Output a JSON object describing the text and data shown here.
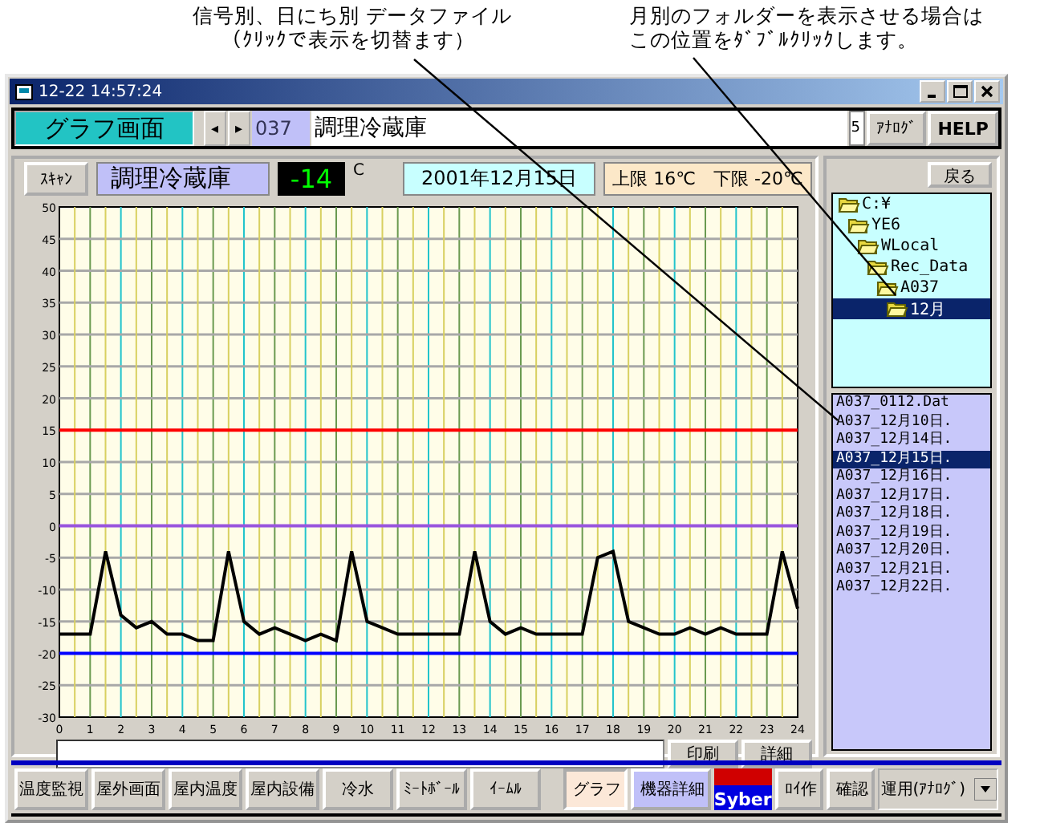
{
  "annotations": [
    {
      "text": "信号別、日にち別  データファイル",
      "subtext": "（ｸﾘｯｸで表示を切替ます）"
    },
    {
      "text": "月別のフォルダーを表示させる場合は",
      "subtext": "この位置をﾀﾞﾌﾞﾙｸﾘｯｸします。"
    }
  ],
  "window": {
    "title": "12-22 14:57:24"
  },
  "toolbar": {
    "screen_name": "グラフ画面",
    "prev": "◂",
    "next": "▸",
    "channel_no": "037",
    "channel_name": "調理冷蔵庫",
    "spin": "5",
    "analog_button": "ｱﾅﾛｸﾞ",
    "help_button": "HELP"
  },
  "header": {
    "scan_button": "ｽｷｬﾝ",
    "name": "調理冷蔵庫",
    "reading": "-14",
    "unit": "C",
    "date": "2001年12月15日",
    "limits": "上限 16℃　下限 -20℃"
  },
  "chart_data": {
    "type": "line",
    "x": [
      0,
      0.5,
      1,
      1.5,
      2,
      2.5,
      3,
      3.5,
      4,
      4.5,
      5,
      5.5,
      6,
      6.5,
      7,
      7.5,
      8,
      8.5,
      9,
      9.5,
      10,
      10.5,
      11,
      11.5,
      12,
      12.5,
      13,
      13.5,
      14,
      14.5,
      15,
      15.5,
      16,
      16.5,
      17,
      17.5,
      18,
      18.5,
      19,
      19.5,
      20,
      20.5,
      21,
      21.5,
      22,
      22.5,
      23,
      23.5,
      24
    ],
    "series": [
      {
        "color": "#000000",
        "values": [
          -17,
          -17,
          -17,
          -4,
          -14,
          -16,
          -15,
          -17,
          -17,
          -18,
          -18,
          -4,
          -15,
          -17,
          -16,
          -17,
          -18,
          -17,
          -18,
          -4,
          -15,
          -16,
          -17,
          -17,
          -17,
          -17,
          -17,
          -4,
          -15,
          -17,
          -16,
          -17,
          -17,
          -17,
          -17,
          -5,
          -4,
          -15,
          -16,
          -17,
          -17,
          -16,
          -17,
          -16,
          -17,
          -17,
          -17,
          -4,
          -13
        ]
      }
    ],
    "xlim": [
      0,
      24
    ],
    "ylim": [
      -30,
      50
    ],
    "xticks": [
      0,
      1,
      2,
      3,
      4,
      5,
      6,
      7,
      8,
      9,
      10,
      11,
      12,
      13,
      14,
      15,
      16,
      17,
      18,
      19,
      20,
      21,
      22,
      23,
      24
    ],
    "yticks": [
      50,
      45,
      40,
      35,
      30,
      25,
      20,
      15,
      10,
      5,
      0,
      -5,
      -10,
      -15,
      -20,
      -25,
      -30
    ],
    "grid": true,
    "ref_lines": [
      {
        "axis": "x",
        "value": 0.5,
        "color": "#d8d060"
      },
      {
        "axis": "x",
        "value": 1.5,
        "color": "#d8d060"
      },
      {
        "axis": "x",
        "value": 2.5,
        "color": "#d8d060"
      },
      {
        "axis": "x",
        "value": 3.5,
        "color": "#d8d060"
      },
      {
        "axis": "x",
        "value": 4.5,
        "color": "#d8d060"
      },
      {
        "axis": "x",
        "value": 5.5,
        "color": "#d8d060"
      },
      {
        "axis": "x",
        "value": 6.5,
        "color": "#d8d060"
      },
      {
        "axis": "x",
        "value": 7.5,
        "color": "#d8d060"
      },
      {
        "axis": "x",
        "value": 8.5,
        "color": "#d8d060"
      },
      {
        "axis": "x",
        "value": 9.5,
        "color": "#d8d060"
      },
      {
        "axis": "x",
        "value": 10.5,
        "color": "#d8d060"
      },
      {
        "axis": "x",
        "value": 11.5,
        "color": "#d8d060"
      },
      {
        "axis": "x",
        "value": 12.5,
        "color": "#d8d060"
      },
      {
        "axis": "x",
        "value": 13.5,
        "color": "#d8d060"
      },
      {
        "axis": "x",
        "value": 14.5,
        "color": "#d8d060"
      },
      {
        "axis": "x",
        "value": 15.5,
        "color": "#d8d060"
      },
      {
        "axis": "x",
        "value": 16.5,
        "color": "#d8d060"
      },
      {
        "axis": "x",
        "value": 17.5,
        "color": "#d8d060"
      },
      {
        "axis": "x",
        "value": 18.5,
        "color": "#d8d060"
      },
      {
        "axis": "x",
        "value": 19.5,
        "color": "#d8d060"
      },
      {
        "axis": "x",
        "value": 20.5,
        "color": "#d8d060"
      },
      {
        "axis": "x",
        "value": 21.5,
        "color": "#d8d060"
      },
      {
        "axis": "x",
        "value": 22.5,
        "color": "#d8d060"
      },
      {
        "axis": "x",
        "value": 23.5,
        "color": "#d8d060"
      },
      {
        "axis": "y",
        "value": 15,
        "color": "#ff0000"
      },
      {
        "axis": "y",
        "value": 0,
        "color": "#9955dd"
      },
      {
        "axis": "y",
        "value": -20,
        "color": "#0000ff"
      }
    ]
  },
  "footer": {
    "print_button": "印刷",
    "detail_button": "詳細"
  },
  "side": {
    "back_button": "戻る",
    "folders": [
      {
        "label": "C:¥",
        "selected": false,
        "children": [
          {
            "label": "YE6",
            "selected": false,
            "children": [
              {
                "label": "WLocal",
                "selected": false,
                "children": [
                  {
                    "label": "Rec_Data",
                    "selected": false,
                    "children": [
                      {
                        "label": "A037",
                        "selected": false,
                        "children": [
                          {
                            "label": "12月",
                            "selected": true
                          }
                        ]
                      }
                    ]
                  }
                ]
              }
            ]
          }
        ]
      }
    ],
    "files": [
      {
        "label": "A037_0112.Dat",
        "selected": false
      },
      {
        "label": "A037_12月10日.",
        "selected": false
      },
      {
        "label": "A037_12月14日.",
        "selected": false
      },
      {
        "label": "A037_12月15日.",
        "selected": true
      },
      {
        "label": "A037_12月16日.",
        "selected": false
      },
      {
        "label": "A037_12月17日.",
        "selected": false
      },
      {
        "label": "A037_12月18日.",
        "selected": false
      },
      {
        "label": "A037_12月19日.",
        "selected": false
      },
      {
        "label": "A037_12月20日.",
        "selected": false
      },
      {
        "label": "A037_12月21日.",
        "selected": false
      },
      {
        "label": "A037_12月22日.",
        "selected": false
      }
    ]
  },
  "nav_buttons": [
    {
      "label": "温度監視",
      "selected": false
    },
    {
      "label": "屋外画面",
      "selected": false
    },
    {
      "label": "屋内温度",
      "selected": false
    },
    {
      "label": "屋内設備",
      "selected": false
    },
    {
      "label": "冷水",
      "selected": false
    },
    {
      "label": "ﾐｰﾄﾎﾞｰﾙ",
      "selected": false
    },
    {
      "label": "ｲｰﾑﾙ",
      "selected": false
    }
  ],
  "view_buttons": [
    {
      "label": "グラフ",
      "selected": true
    },
    {
      "label": "機器詳細",
      "selected": false
    }
  ],
  "logo": "Syber",
  "tool_buttons": [
    "ﾛｲ作",
    "確認"
  ],
  "mode_select": "運用(ｱﾅﾛｸﾞ)"
}
